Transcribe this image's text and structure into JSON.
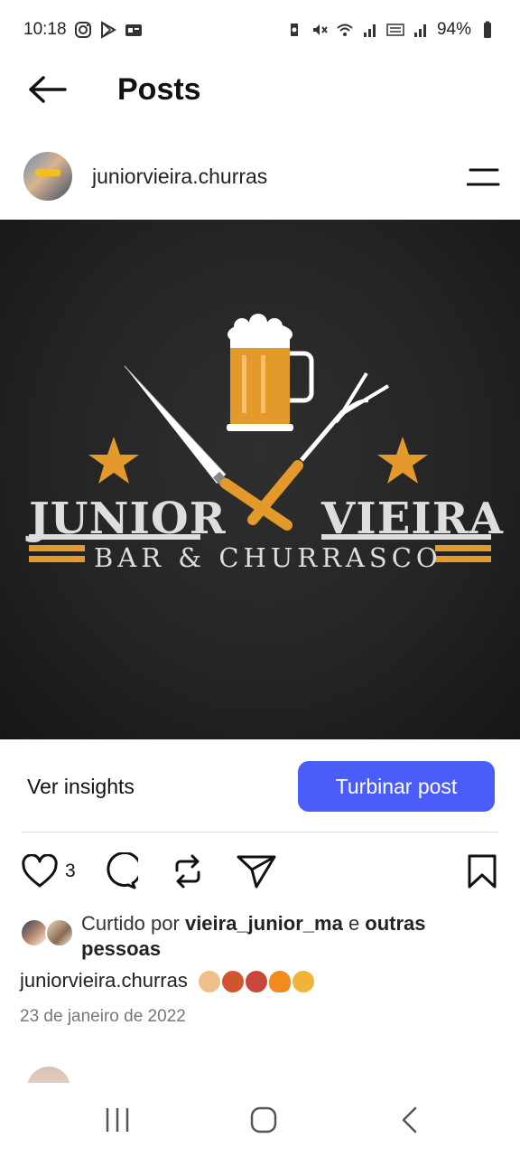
{
  "status_bar": {
    "time": "10:18",
    "battery": "94%"
  },
  "header": {
    "title": "Posts"
  },
  "post": {
    "username": "juniorvieira.churras",
    "logo": {
      "left_word": "JUNIOR",
      "right_word": "VIEIRA",
      "subtitle": "BAR & CHURRASCO"
    },
    "insights_label": "Ver insights",
    "boost_label": "Turbinar post",
    "like_count": "3",
    "liked_by_prefix": "Curtido por ",
    "liked_by_user": "vieira_junior_ma",
    "liked_by_suffix": " e ",
    "liked_by_others": "outras pessoas",
    "caption_username": "juniorvieira.churras",
    "date": "23 de janeiro de 2022"
  },
  "colors": {
    "accent": "#4a5df9",
    "logo_orange": "#e49a2b"
  },
  "icons": [
    "back-arrow-icon",
    "menu-icon",
    "heart-icon",
    "comment-icon",
    "repost-icon",
    "send-icon",
    "bookmark-icon"
  ]
}
